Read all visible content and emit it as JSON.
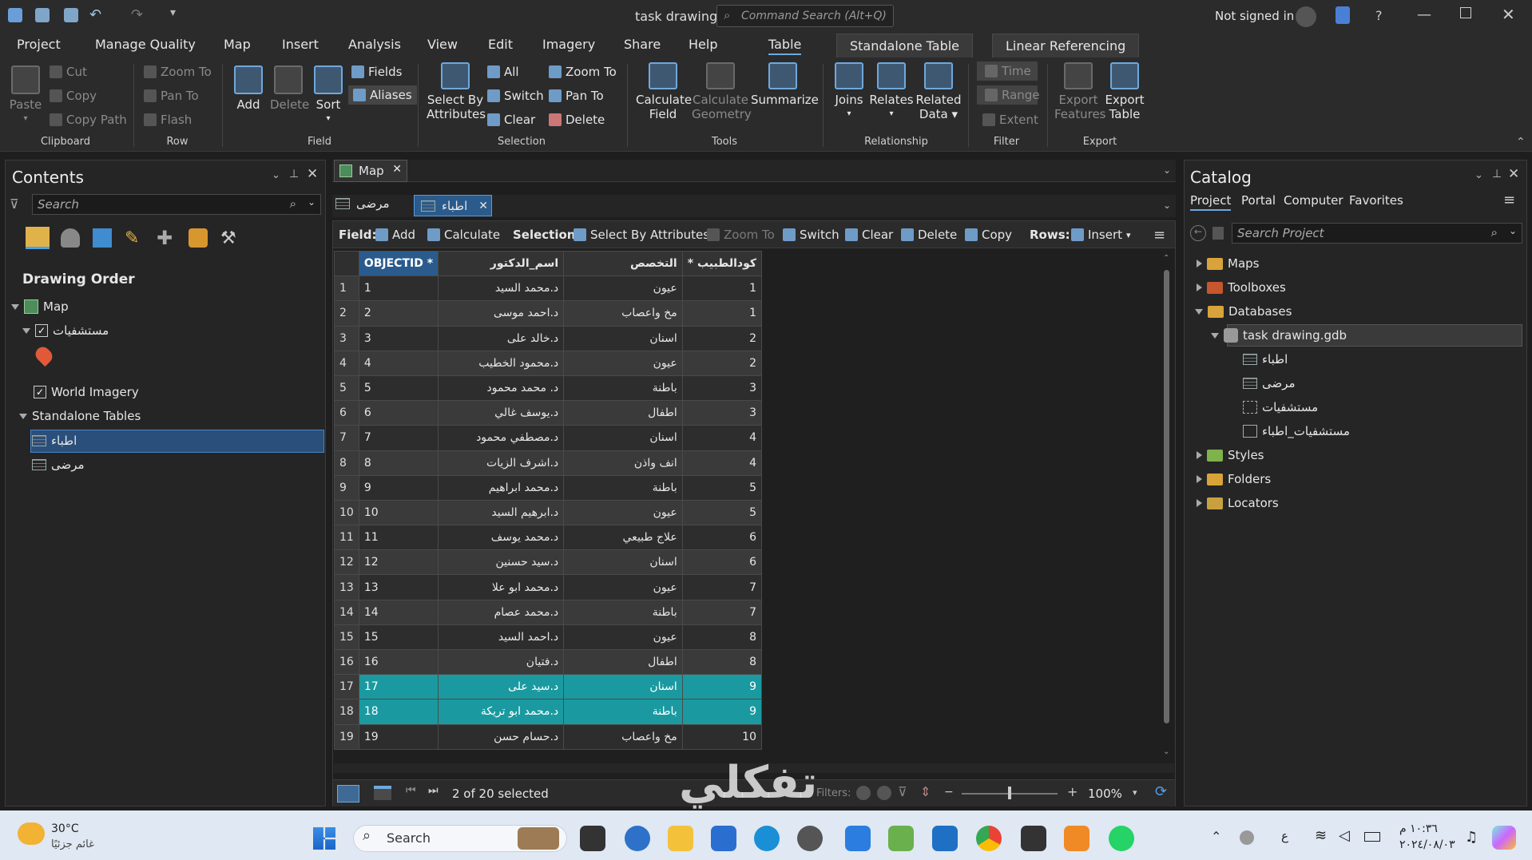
{
  "titlebar": {
    "title": "task drawing",
    "command_search_placeholder": "Command Search (Alt+Q)",
    "signin": "Not signed in",
    "help": "?"
  },
  "menu": {
    "tabs": [
      "Project",
      "Manage Quality",
      "Map",
      "Insert",
      "Analysis",
      "View",
      "Edit",
      "Imagery",
      "Share",
      "Help",
      "Table"
    ],
    "context_tabs": [
      "Standalone Table",
      "Linear Referencing"
    ]
  },
  "ribbon": {
    "clipboard": {
      "paste": "Paste",
      "cut": "Cut",
      "copy": "Copy",
      "copy_path": "Copy Path",
      "group": "Clipboard"
    },
    "row": {
      "zoom_to": "Zoom To",
      "pan_to": "Pan To",
      "flash": "Flash",
      "group": "Row"
    },
    "field": {
      "add": "Add",
      "delete": "Delete",
      "sort": "Sort",
      "fields": "Fields",
      "aliases": "Aliases",
      "group": "Field"
    },
    "selection": {
      "select_by_attr_1": "Select By",
      "select_by_attr_2": "Attributes",
      "all": "All",
      "switch": "Switch",
      "clear": "Clear",
      "zoom_to": "Zoom To",
      "pan_to": "Pan To",
      "delete": "Delete",
      "group": "Selection"
    },
    "tools": {
      "calc_field_1": "Calculate",
      "calc_field_2": "Field",
      "calc_geom_1": "Calculate",
      "calc_geom_2": "Geometry",
      "summarize": "Summarize",
      "group": "Tools"
    },
    "relationship": {
      "joins": "Joins",
      "relates": "Relates",
      "related_1": "Related",
      "related_2": "Data",
      "group": "Relationship"
    },
    "filter": {
      "time": "Time",
      "range": "Range",
      "extent": "Extent",
      "group": "Filter"
    },
    "export": {
      "export_features_1": "Export",
      "export_features_2": "Features",
      "export_table_1": "Export",
      "export_table_2": "Table",
      "group": "Export"
    }
  },
  "contents": {
    "title": "Contents",
    "search_placeholder": "Search",
    "drawing_order": "Drawing Order",
    "map": "Map",
    "layer_hospitals": "مستشفيات",
    "layer_imagery": "World Imagery",
    "standalone_tables": "Standalone Tables",
    "table_doctors": "اطباء",
    "table_patients": "مرضى"
  },
  "view_tabs": {
    "map": "Map",
    "patients": "مرضى",
    "doctors": "اطباء"
  },
  "table_toolbar": {
    "field_label": "Field:",
    "add": "Add",
    "calculate": "Calculate",
    "selection_label": "Selection:",
    "select_by_attributes": "Select By Attributes",
    "zoom_to": "Zoom To",
    "switch": "Switch",
    "clear": "Clear",
    "delete": "Delete",
    "copy": "Copy",
    "rows_label": "Rows:",
    "insert": "Insert"
  },
  "table": {
    "columns": [
      "OBJECTID *",
      "اسم_الدكتور",
      "التخصص",
      "* كودالطبيب"
    ],
    "rows": [
      {
        "n": "1",
        "oid": "1",
        "name": "د.محمد السيد",
        "spec": "عيون",
        "code": "1",
        "sel": false
      },
      {
        "n": "2",
        "oid": "2",
        "name": "د.احمد موسى",
        "spec": "مخ واعصاب",
        "code": "1",
        "sel": false
      },
      {
        "n": "3",
        "oid": "3",
        "name": "د.خالد على",
        "spec": "اسنان",
        "code": "2",
        "sel": false
      },
      {
        "n": "4",
        "oid": "4",
        "name": "د.محمود الخطيب",
        "spec": "عيون",
        "code": "2",
        "sel": false
      },
      {
        "n": "5",
        "oid": "5",
        "name": "د. محمد محمود",
        "spec": "باطنة",
        "code": "3",
        "sel": false
      },
      {
        "n": "6",
        "oid": "6",
        "name": "د.يوسف غالي",
        "spec": "اطفال",
        "code": "3",
        "sel": false
      },
      {
        "n": "7",
        "oid": "7",
        "name": "د.مصطفي محمود",
        "spec": "اسنان",
        "code": "4",
        "sel": false
      },
      {
        "n": "8",
        "oid": "8",
        "name": "د.اشرف الزيات",
        "spec": "انف واذن",
        "code": "4",
        "sel": false
      },
      {
        "n": "9",
        "oid": "9",
        "name": "د.محمد ابراهيم",
        "spec": "باطنة",
        "code": "5",
        "sel": false
      },
      {
        "n": "10",
        "oid": "10",
        "name": "د.ابرهيم السيد",
        "spec": "عيون",
        "code": "5",
        "sel": false
      },
      {
        "n": "11",
        "oid": "11",
        "name": "د.محمد يوسف",
        "spec": "علاج طبيعي",
        "code": "6",
        "sel": false
      },
      {
        "n": "12",
        "oid": "12",
        "name": "د.سيد حسنين",
        "spec": "اسنان",
        "code": "6",
        "sel": false
      },
      {
        "n": "13",
        "oid": "13",
        "name": "د.محمد ابو علا",
        "spec": "عيون",
        "code": "7",
        "sel": false
      },
      {
        "n": "14",
        "oid": "14",
        "name": "د.محمد عصام",
        "spec": "باطنة",
        "code": "7",
        "sel": false
      },
      {
        "n": "15",
        "oid": "15",
        "name": "د.احمد السيد",
        "spec": "عيون",
        "code": "8",
        "sel": false
      },
      {
        "n": "16",
        "oid": "16",
        "name": "د.فتيان",
        "spec": "اطفال",
        "code": "8",
        "sel": false
      },
      {
        "n": "17",
        "oid": "17",
        "name": "د.سيد على",
        "spec": "اسنان",
        "code": "9",
        "sel": true
      },
      {
        "n": "18",
        "oid": "18",
        "name": "د.محمد ابو تريكة",
        "spec": "باطنة",
        "code": "9",
        "sel": true
      },
      {
        "n": "19",
        "oid": "19",
        "name": "د.حسام حسن",
        "spec": "مخ واعصاب",
        "code": "10",
        "sel": false
      }
    ]
  },
  "status": {
    "selected": "2 of 20 selected",
    "zoom": "100%",
    "filters": "Filters:"
  },
  "catalog": {
    "title": "Catalog",
    "tabs": [
      "Project",
      "Portal",
      "Computer",
      "Favorites"
    ],
    "search_placeholder": "Search Project",
    "items": {
      "maps": "Maps",
      "toolboxes": "Toolboxes",
      "databases": "Databases",
      "gdb": "task drawing.gdb",
      "t1": "اطباء",
      "t2": "مرضى",
      "t3": "مستشفيات",
      "t4": "مستشفيات_اطباء",
      "styles": "Styles",
      "folders": "Folders",
      "locators": "Locators"
    }
  },
  "watermark": "تفكلي",
  "taskbar": {
    "temp": "30°C",
    "weather": "غائم جزئيًا",
    "search": "Search",
    "time": "١٠:٣٦ م",
    "date": "٢٠٢٤/٠٨/٠٣",
    "lang": "ع"
  }
}
